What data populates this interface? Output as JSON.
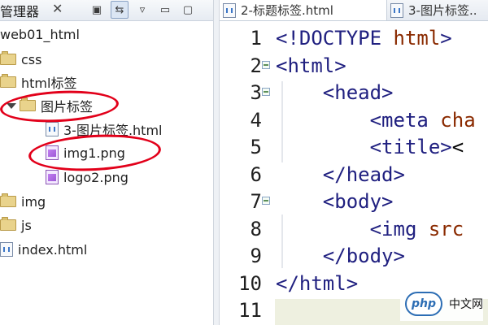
{
  "explorer": {
    "title": "管理器",
    "close_symbol": "✕",
    "toolbar": {
      "collapse_icon": "collapse-all-icon",
      "link_icon": "link-with-editor-icon",
      "view_menu_icon": "view-menu-icon",
      "minimize_icon": "minimize-icon",
      "maximize_icon": "maximize-icon"
    },
    "items": [
      {
        "label": "web01_html",
        "type": "project"
      },
      {
        "label": "css",
        "type": "folder"
      },
      {
        "label": "html标签",
        "type": "folder"
      },
      {
        "label": "图片标签",
        "type": "folder",
        "expanded": true,
        "highlighted": true
      },
      {
        "label": "3-图片标签.html",
        "type": "html-file"
      },
      {
        "label": "img1.png",
        "type": "png-file",
        "highlighted": true
      },
      {
        "label": "logo2.png",
        "type": "png-file"
      },
      {
        "label": "img",
        "type": "folder"
      },
      {
        "label": "js",
        "type": "folder"
      },
      {
        "label": "index.html",
        "type": "html-file"
      }
    ]
  },
  "editor": {
    "tabs": [
      {
        "label": "2-标题标签.html",
        "active": true
      },
      {
        "label": "3-图片标签..",
        "active": false
      }
    ],
    "lines": [
      {
        "num": "1",
        "code": "<!DOCTYPE html>",
        "fold": false
      },
      {
        "num": "2",
        "code": "<html>",
        "fold": true
      },
      {
        "num": "3",
        "code": "    <head>",
        "fold": true
      },
      {
        "num": "4",
        "code": "        <meta cha",
        "fold": false
      },
      {
        "num": "5",
        "code": "        <title><",
        "fold": false
      },
      {
        "num": "6",
        "code": "    </head>",
        "fold": false
      },
      {
        "num": "7",
        "code": "    <body>",
        "fold": true
      },
      {
        "num": "8",
        "code": "        <img src",
        "fold": false
      },
      {
        "num": "9",
        "code": "    </body>",
        "fold": false
      },
      {
        "num": "10",
        "code": "</html>",
        "fold": false
      },
      {
        "num": "11",
        "code": "",
        "fold": false
      }
    ]
  },
  "watermark": {
    "logo_text": "php",
    "site_text": "中文网"
  },
  "colors": {
    "highlight_ellipse": "#e2001a",
    "tag_text": "#202080",
    "attr_text": "#8a2a00",
    "current_line": "#eef0e0"
  }
}
